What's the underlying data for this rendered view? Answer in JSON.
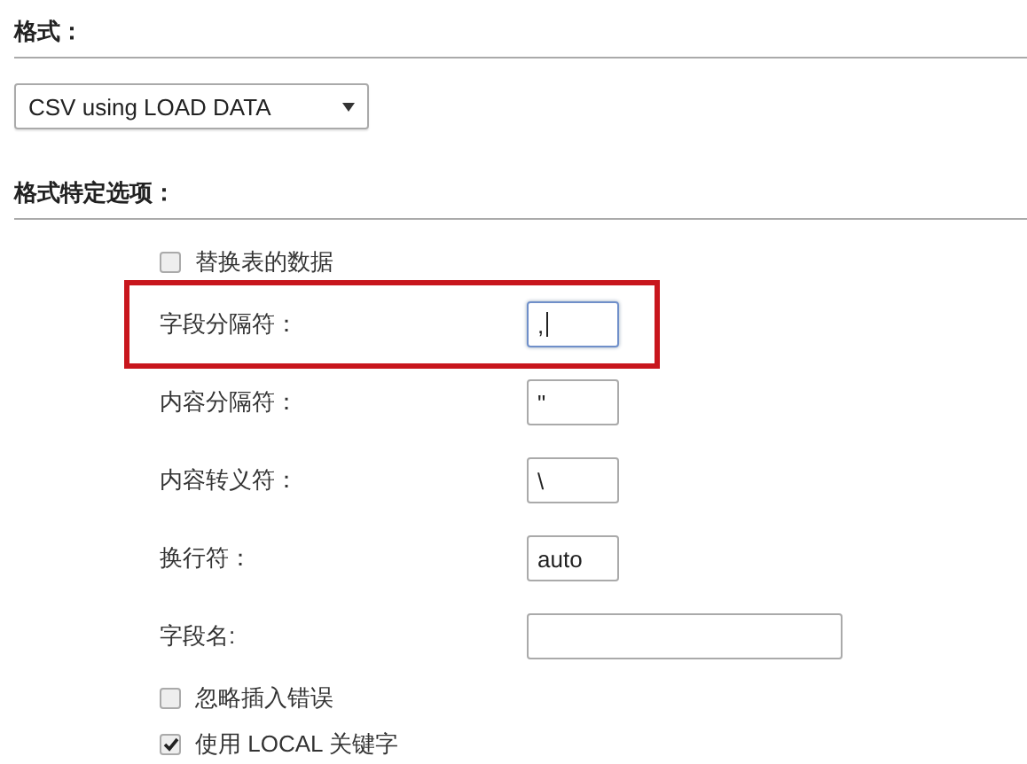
{
  "format": {
    "heading": "格式：",
    "select": {
      "value": "CSV using LOAD DATA"
    }
  },
  "options": {
    "heading": "格式特定选项：",
    "items": [
      {
        "kind": "checkbox",
        "label": "替换表的数据",
        "checked": false
      },
      {
        "kind": "field",
        "label": "字段分隔符：",
        "value": ",",
        "focused": true,
        "highlighted": true
      },
      {
        "kind": "field",
        "label": "内容分隔符：",
        "value": "\"",
        "focused": false,
        "highlighted": false
      },
      {
        "kind": "field",
        "label": "内容转义符：",
        "value": "\\",
        "focused": false,
        "highlighted": false
      },
      {
        "kind": "field",
        "label": "换行符：",
        "value": "auto",
        "focused": false,
        "highlighted": false
      },
      {
        "kind": "wide-field",
        "label": "字段名:",
        "focused": false,
        "highlighted": false
      },
      {
        "kind": "checkbox",
        "label": "忽略插入错误",
        "checked": false
      },
      {
        "kind": "checkbox",
        "label": "使用 LOCAL 关键字",
        "checked": true
      }
    ]
  }
}
